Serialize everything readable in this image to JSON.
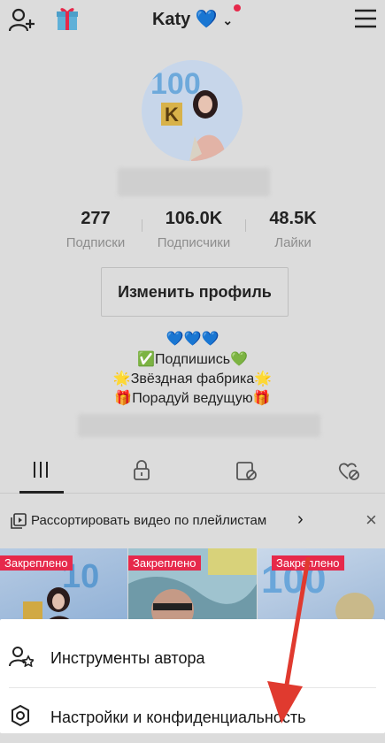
{
  "header": {
    "username": "Katy",
    "heart_emoji": "💙",
    "add_friend_icon": "add-user-icon",
    "gift_icon": "gift-icon",
    "menu_icon": "hamburger-icon"
  },
  "stats": [
    {
      "value": "277",
      "label": "Подписки"
    },
    {
      "value": "106.0K",
      "label": "Подписчики"
    },
    {
      "value": "48.5K",
      "label": "Лайки"
    }
  ],
  "edit_profile_label": "Изменить профиль",
  "bio": [
    "💙💙💙",
    "✅Подпишись💚",
    "🌟Звёздная фабрика🌟",
    "🎁Порадуй ведущую🎁"
  ],
  "tabs": [
    {
      "icon": "grid-icon",
      "active": true
    },
    {
      "icon": "lock-icon",
      "active": false
    },
    {
      "icon": "tag-icon",
      "active": false
    },
    {
      "icon": "liked-icon",
      "active": false
    }
  ],
  "playlist_banner": {
    "text": "Рассортировать видео по плейлистам",
    "chevron": "›",
    "close": "×"
  },
  "thumbnails": [
    {
      "label": "Закреплено"
    },
    {
      "label": "Закреплено"
    },
    {
      "label": "Закреплено"
    }
  ],
  "sheet": {
    "items": [
      {
        "label": "Инструменты автора",
        "icon": "creator-tools-icon"
      },
      {
        "label": "Настройки и конфиденциальность",
        "icon": "settings-gear-icon"
      }
    ]
  },
  "colors": {
    "accent_red": "#e6294b",
    "arrow_red": "#e03a2f",
    "overlay": "#dcdcdc"
  }
}
